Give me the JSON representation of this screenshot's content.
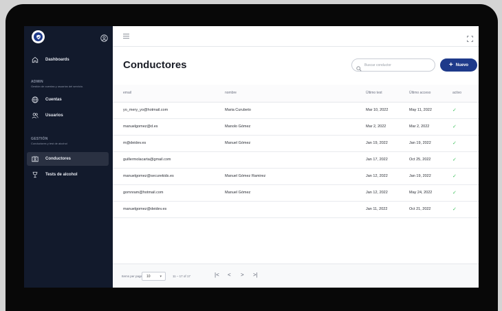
{
  "sidebar": {
    "dashboards": "Dashboards",
    "admin_title": "ADMIN",
    "admin_sub": "Gestión de cuentas y usuarios del servicio.",
    "cuentas": "Cuentas",
    "usuarios": "Usuarios",
    "gestion_title": "GESTIÓN",
    "gestion_sub": "Conductores y test de alcohol",
    "conductores": "Conductores",
    "tests": "Tests de alcohol"
  },
  "header": {
    "title": "Conductores",
    "search_placeholder": "Buscar conductor",
    "new_button": "Nuevo"
  },
  "table": {
    "columns": [
      "email",
      "nombre",
      "Último test",
      "Último acceso",
      "activo"
    ],
    "rows": [
      {
        "email": "yo_mery_yo@hotmail.com",
        "nombre": "Maria Curubeto",
        "ultimo_test": "Mar 10, 2022",
        "ultimo_acceso": "May 11, 2022",
        "activo": "✓"
      },
      {
        "email": "manuelgomez@d.es",
        "nombre": "Manolo Gómez",
        "ultimo_test": "Mar 2, 2022",
        "ultimo_acceso": "Mar 2, 2022",
        "activo": "✓"
      },
      {
        "email": "m@deidev.es",
        "nombre": "Manuel Gómez",
        "ultimo_test": "Jan 19, 2022",
        "ultimo_acceso": "Jan 19, 2022",
        "activo": "✓"
      },
      {
        "email": "guillermolacarta@gmail.com",
        "nombre": "",
        "ultimo_test": "Jan 17, 2022",
        "ultimo_acceso": "Oct 25, 2022",
        "activo": "✓"
      },
      {
        "email": "manuelgomez@securekids.es",
        "nombre": "Manuel Gómez Ramirez",
        "ultimo_test": "Jan 12, 2022",
        "ultimo_acceso": "Jan 19, 2022",
        "activo": "✓"
      },
      {
        "email": "gomnram@hotmail.com",
        "nombre": "Manuel Gómez",
        "ultimo_test": "Jan 12, 2022",
        "ultimo_acceso": "May 24, 2022",
        "activo": "✓"
      },
      {
        "email": "manuelgomez@deidev.es",
        "nombre": "",
        "ultimo_test": "Jan 11, 2022",
        "ultimo_acceso": "Oct 21, 2022",
        "activo": "✓"
      }
    ]
  },
  "pagination": {
    "items_per_page_label": "Items per page:",
    "items_per_page_value": "10",
    "range": "11 – 17 of 17",
    "first": "|<",
    "prev": "<",
    "next": ">",
    "last": ">|"
  },
  "colors": {
    "sidebar_bg": "#121a2c",
    "accent": "#1e3a8a",
    "check": "#3ec15c"
  }
}
